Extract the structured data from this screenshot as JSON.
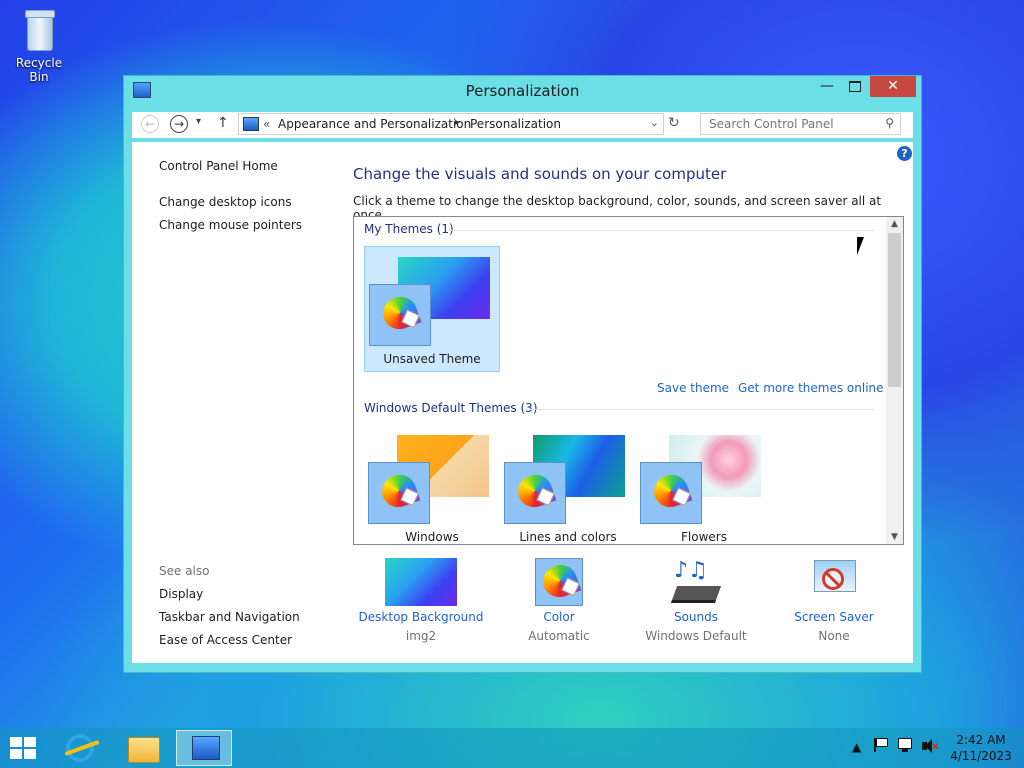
{
  "desktop": {
    "recycle_bin_label": "Recycle Bin"
  },
  "window": {
    "title": "Personalization",
    "controls": {
      "minimize": "—",
      "close": "✕"
    }
  },
  "nav": {
    "back": "←",
    "forward": "→",
    "recent": "▾",
    "up": "↑",
    "address": {
      "overflow": "«",
      "crumb1": "Appearance and Personalization",
      "sep": "▸",
      "crumb2": "Personalization",
      "dropdown": "⌄"
    },
    "refresh": "↻",
    "search_placeholder": "Search Control Panel",
    "search_icon": "⚲"
  },
  "left_pane": {
    "home": "Control Panel Home",
    "links": [
      "Change desktop icons",
      "Change mouse pointers"
    ],
    "see_also_header": "See also",
    "see_also": [
      "Display",
      "Taskbar and Navigation",
      "Ease of Access Center"
    ]
  },
  "main": {
    "help": "?",
    "heading": "Change the visuals and sounds on your computer",
    "subheading": "Click a theme to change the desktop background, color, sounds, and screen saver all at once.",
    "my_themes_header": "My Themes (1)",
    "my_themes": [
      {
        "name": "Unsaved Theme",
        "selected": true
      }
    ],
    "save_theme": "Save theme",
    "get_more": "Get more themes online",
    "default_header": "Windows Default Themes (3)",
    "default_themes": [
      {
        "name": "Windows"
      },
      {
        "name": "Lines and colors"
      },
      {
        "name": "Flowers"
      }
    ],
    "scroll_up": "▲",
    "scroll_down": "▼"
  },
  "bottom": [
    {
      "label": "Desktop Background",
      "value": "img2"
    },
    {
      "label": "Color",
      "value": "Automatic"
    },
    {
      "label": "Sounds",
      "value": "Windows Default"
    },
    {
      "label": "Screen Saver",
      "value": "None"
    }
  ],
  "taskbar": {
    "tray_chevron": "▲",
    "clock_time": "2:42 AM",
    "clock_date": "4/11/2023"
  },
  "colors": {
    "link": "#1e64c8",
    "heading": "#1e3287",
    "close_button": "#c7483e",
    "window_frame": "#6cdfe6"
  }
}
